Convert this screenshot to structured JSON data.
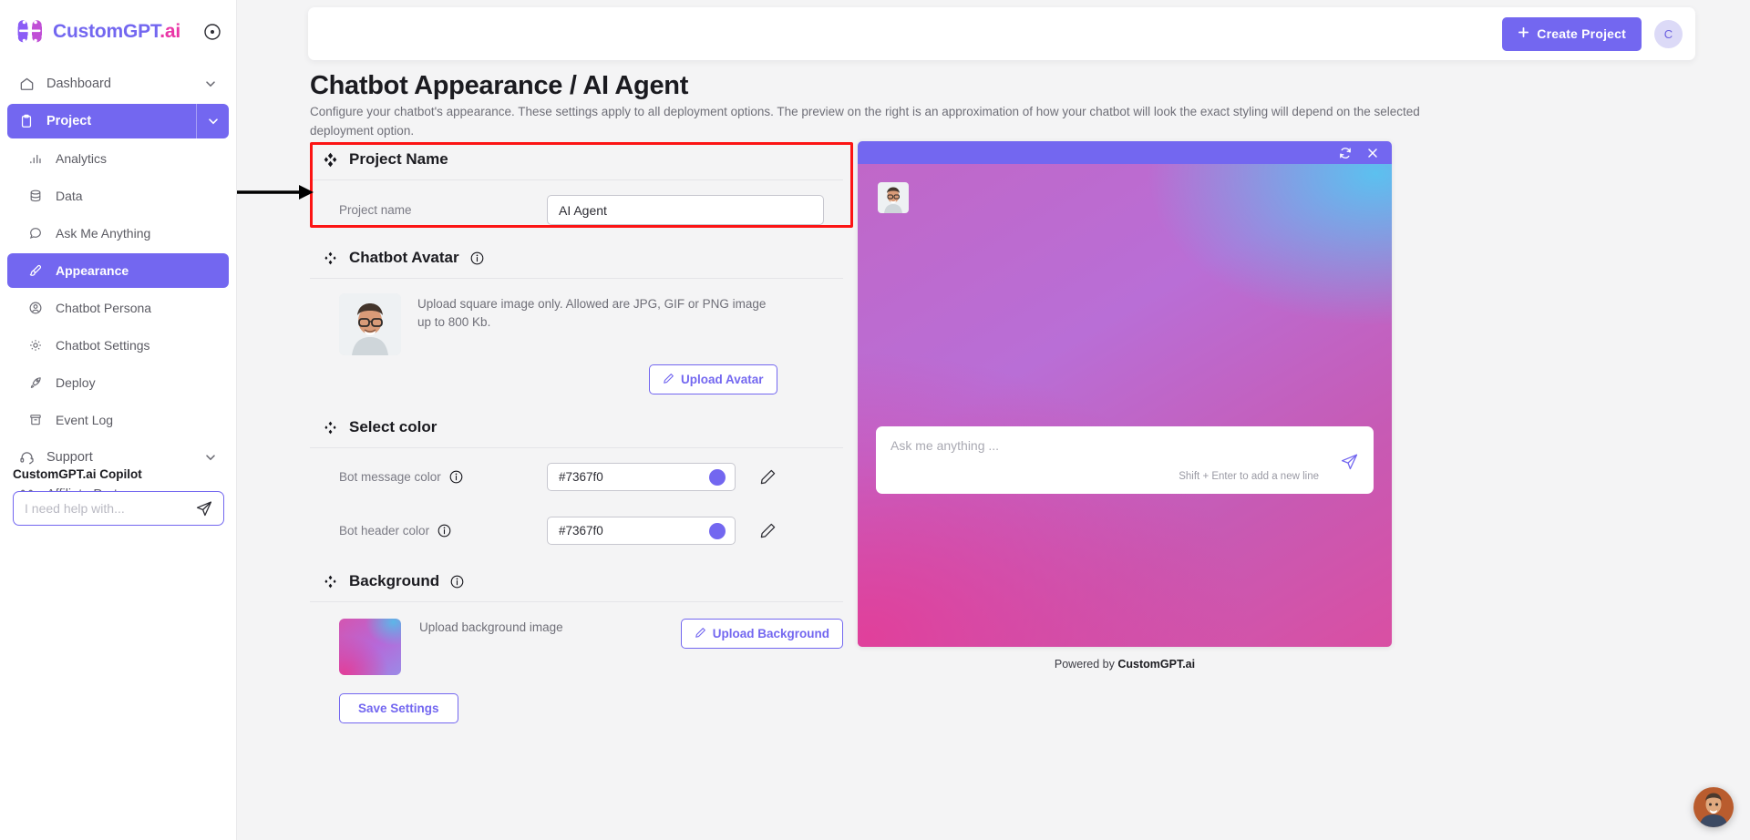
{
  "brand": {
    "name_part1": "CustomGPT",
    "name_part2": ".ai",
    "logo_icon": "brain-logo-icon",
    "toggle_icon": "circle-dot-icon"
  },
  "sidebar": {
    "items": [
      {
        "label": "Dashboard",
        "icon": "home-icon",
        "level": "top",
        "chevron": true,
        "active": false
      },
      {
        "label": "Project",
        "icon": "clipboard-icon",
        "level": "top",
        "chevron": true,
        "active": true
      },
      {
        "label": "Analytics",
        "icon": "bar-chart-icon",
        "level": "sub",
        "chevron": false,
        "active": false
      },
      {
        "label": "Data",
        "icon": "database-icon",
        "level": "sub",
        "chevron": false,
        "active": false
      },
      {
        "label": "Ask Me Anything",
        "icon": "chat-bubble-icon",
        "level": "sub",
        "chevron": false,
        "active": false
      },
      {
        "label": "Appearance",
        "icon": "paintbrush-icon",
        "level": "sub",
        "chevron": false,
        "active": true
      },
      {
        "label": "Chatbot Persona",
        "icon": "user-circle-icon",
        "level": "sub",
        "chevron": false,
        "active": false
      },
      {
        "label": "Chatbot Settings",
        "icon": "gear-icon",
        "level": "sub",
        "chevron": false,
        "active": false
      },
      {
        "label": "Deploy",
        "icon": "rocket-icon",
        "level": "sub",
        "chevron": false,
        "active": false
      },
      {
        "label": "Event Log",
        "icon": "archive-icon",
        "level": "sub",
        "chevron": false,
        "active": false
      },
      {
        "label": "Support",
        "icon": "headset-icon",
        "level": "top",
        "chevron": true,
        "active": false
      },
      {
        "label": "Affiliate Partners",
        "icon": "share-nodes-icon",
        "level": "top",
        "chevron": false,
        "active": false
      }
    ],
    "copilot": {
      "title": "CustomGPT.ai Copilot",
      "placeholder": "I need help with...",
      "value": "",
      "send_icon": "paper-plane-icon"
    }
  },
  "topbar": {
    "create_label": "Create Project",
    "plus_icon": "plus-icon",
    "avatar_initial": "C"
  },
  "page": {
    "title": "Chatbot Appearance / AI Agent",
    "subtitle": "Configure your chatbot's appearance. These settings apply to all deployment options. The preview on the right is an approximation of how your chatbot will look the exact styling will depend on the selected deployment option."
  },
  "sections": {
    "project_name": {
      "title": "Project Name",
      "icon": "diamond-cluster-icon",
      "field_label": "Project name",
      "field_value": "AI Agent",
      "highlighted": true,
      "highlight_color": "#fc1414"
    },
    "chatbot_avatar": {
      "title": "Chatbot Avatar",
      "icon": "diamond-cluster-icon",
      "info_icon": "info-circle-icon",
      "help_text": "Upload square image only. Allowed are JPG, GIF or PNG image up to 800 Kb.",
      "upload_label": "Upload Avatar",
      "upload_icon": "pencil-icon"
    },
    "select_color": {
      "title": "Select color",
      "icon": "diamond-cluster-icon",
      "rows": [
        {
          "label": "Bot message color",
          "value": "#7367f0",
          "info_icon": "info-circle-icon",
          "edit_icon": "pencil-icon"
        },
        {
          "label": "Bot header color",
          "value": "#7367f0",
          "info_icon": "info-circle-icon",
          "edit_icon": "pencil-icon"
        }
      ]
    },
    "background": {
      "title": "Background",
      "icon": "diamond-cluster-icon",
      "info_icon": "info-circle-icon",
      "help_text": "Upload background image",
      "upload_label": "Upload Background",
      "upload_icon": "pencil-icon"
    },
    "save_label": "Save Settings"
  },
  "preview": {
    "header_color": "#7367f0",
    "refresh_icon": "refresh-icon",
    "close_icon": "close-icon",
    "bot_avatar_icon": "bot-avatar-image",
    "input_placeholder": "Ask me anything ...",
    "input_hint": "Shift + Enter to add a new line",
    "send_icon": "paper-plane-icon",
    "powered_prefix": "Powered by ",
    "powered_brand": "CustomGPT.ai"
  },
  "floating_widget": {
    "icon": "chat-widget-avatar"
  },
  "colors": {
    "accent": "#7367f0",
    "brand_pink": "#ea36a7",
    "annotation_red": "#fc1414"
  }
}
